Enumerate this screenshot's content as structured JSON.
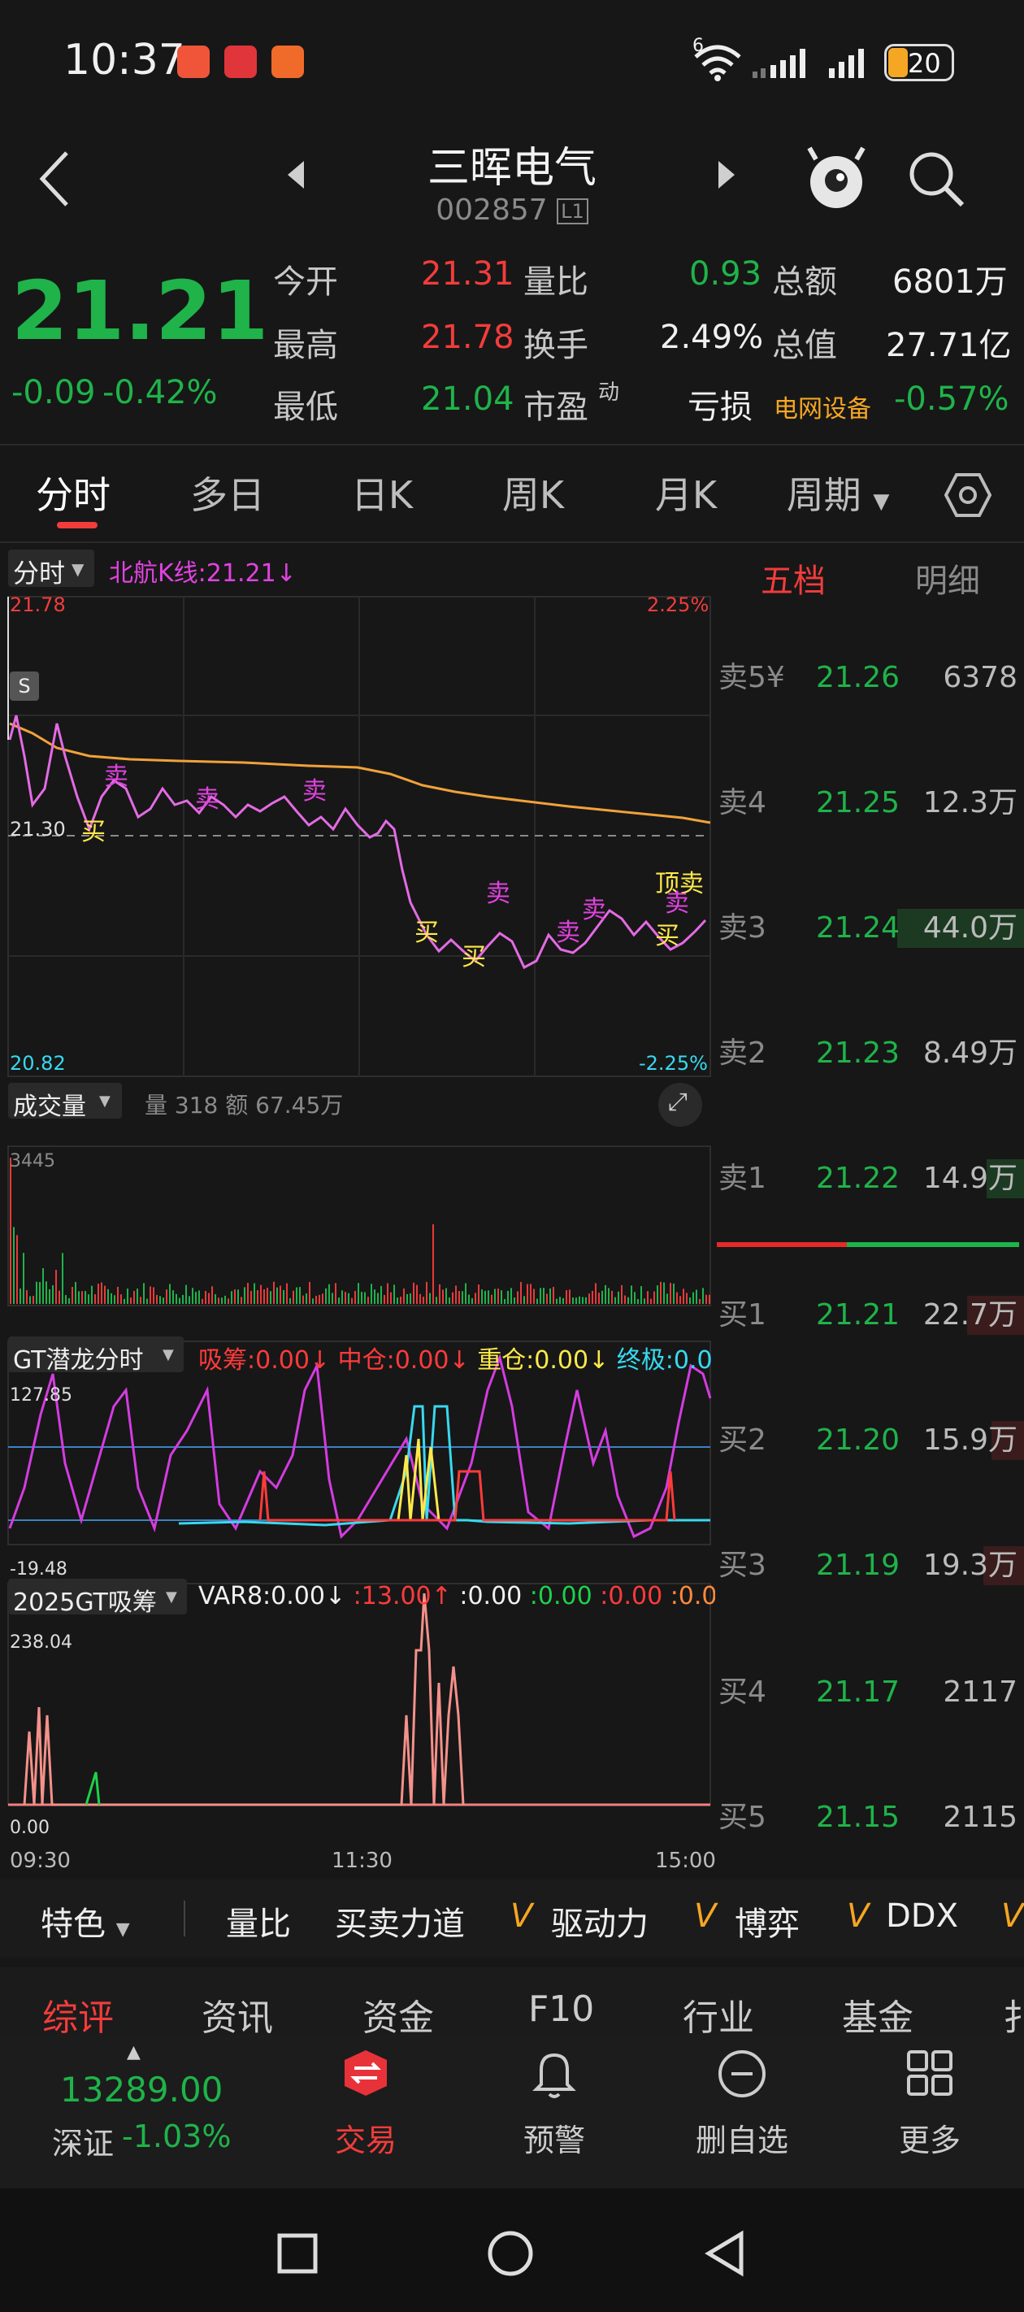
{
  "status": {
    "time": "10:37",
    "battery": "20",
    "signal_label": "6"
  },
  "header": {
    "title": "三晖电气",
    "code": "002857",
    "market_badge": "L1"
  },
  "quote": {
    "price": "21.21",
    "change": "-0.09",
    "change_pct": "-0.42%",
    "open_label": "今开",
    "open": "21.31",
    "high_label": "最高",
    "high": "21.78",
    "low_label": "最低",
    "low": "21.04",
    "vol_ratio_label": "量比",
    "vol_ratio": "0.93",
    "turnover_label": "换手",
    "turnover": "2.49%",
    "pe_label": "市盈",
    "pe_sup": "动",
    "pe": "亏损",
    "amount_label": "总额",
    "amount": "6801万",
    "mktcap_label": "总值",
    "mktcap": "27.71亿",
    "sector": "电网设备",
    "sector_pct": "-0.57%"
  },
  "tabs": [
    {
      "label": "分时"
    },
    {
      "label": "多日"
    },
    {
      "label": "日K"
    },
    {
      "label": "周K"
    },
    {
      "label": "月K"
    },
    {
      "label": "周期"
    }
  ],
  "chart": {
    "mode_label": "分时",
    "beihang": "北航K线:21.21↓",
    "top_price": "21.78",
    "top_pct": "2.25%",
    "mid_price": "21.30",
    "bot_price": "20.82",
    "bot_pct": "-2.25%",
    "s_marker": "S",
    "sig_buy": "买",
    "sig_sell": "卖",
    "sig_top": "顶卖",
    "volume_label": "成交量",
    "volume_info": "量 318  额 67.45万",
    "volume_max": "3445",
    "gt_label": "GT潜龙分时",
    "gt_items": [
      {
        "text": "吸筹:0.00↓",
        "color": "#ff3b3b"
      },
      {
        "text": "中仓:0.00↓",
        "color": "#ff3b3b"
      },
      {
        "text": "重仓:0.00↓",
        "color": "#ffe94a"
      },
      {
        "text": "终极:0.0",
        "color": "#38d9f0"
      }
    ],
    "gt_max": "127.85",
    "gt_min": "-19.48",
    "gt2_label": "2025GT吸筹",
    "gt2_items": [
      {
        "text": "VAR8:0.00↓",
        "color": "#f0f0f0"
      },
      {
        "text": ":13.00↑",
        "color": "#ff3b3b"
      },
      {
        "text": ":0.00",
        "color": "#f0f0f0"
      },
      {
        "text": ":0.00",
        "color": "#1fd14a"
      },
      {
        "text": ":0.00",
        "color": "#ff3b3b"
      },
      {
        "text": ":0.0",
        "color": "#ff8a3b"
      }
    ],
    "gt2_max": "238.04",
    "gt2_min": "0.00",
    "time_start": "09:30",
    "time_mid": "11:30",
    "time_end": "15:00"
  },
  "orderbook": {
    "tab_five": "五档",
    "tab_detail": "明细",
    "asks": [
      {
        "label": "卖5¥",
        "price": "21.26",
        "vol": "6378"
      },
      {
        "label": "卖4",
        "price": "21.25",
        "vol": "12.3万"
      },
      {
        "label": "卖3",
        "price": "21.24",
        "vol": "44.0万"
      },
      {
        "label": "卖2",
        "price": "21.23",
        "vol": "8.49万"
      },
      {
        "label": "卖1",
        "price": "21.22",
        "vol": "14.9万"
      }
    ],
    "bids": [
      {
        "label": "买1",
        "price": "21.21",
        "vol": "22.7万"
      },
      {
        "label": "买2",
        "price": "21.20",
        "vol": "15.9万"
      },
      {
        "label": "买3",
        "price": "21.19",
        "vol": "19.3万"
      },
      {
        "label": "买4",
        "price": "21.17",
        "vol": "2117"
      },
      {
        "label": "买5",
        "price": "21.15",
        "vol": "2115"
      }
    ]
  },
  "featbar": {
    "first": "特色",
    "items": [
      "量比",
      "买卖力道",
      "驱动力",
      "博弈",
      "DDX"
    ]
  },
  "subtabs": [
    "综评",
    "资讯",
    "资金",
    "F10",
    "行业",
    "基金",
    "扌"
  ],
  "bottom": {
    "index_value": "13289.00",
    "index_name": "深证",
    "index_pct": "-1.03%",
    "nav": [
      {
        "label": "交易"
      },
      {
        "label": "预警"
      },
      {
        "label": "删自选"
      },
      {
        "label": "更多"
      }
    ]
  }
}
